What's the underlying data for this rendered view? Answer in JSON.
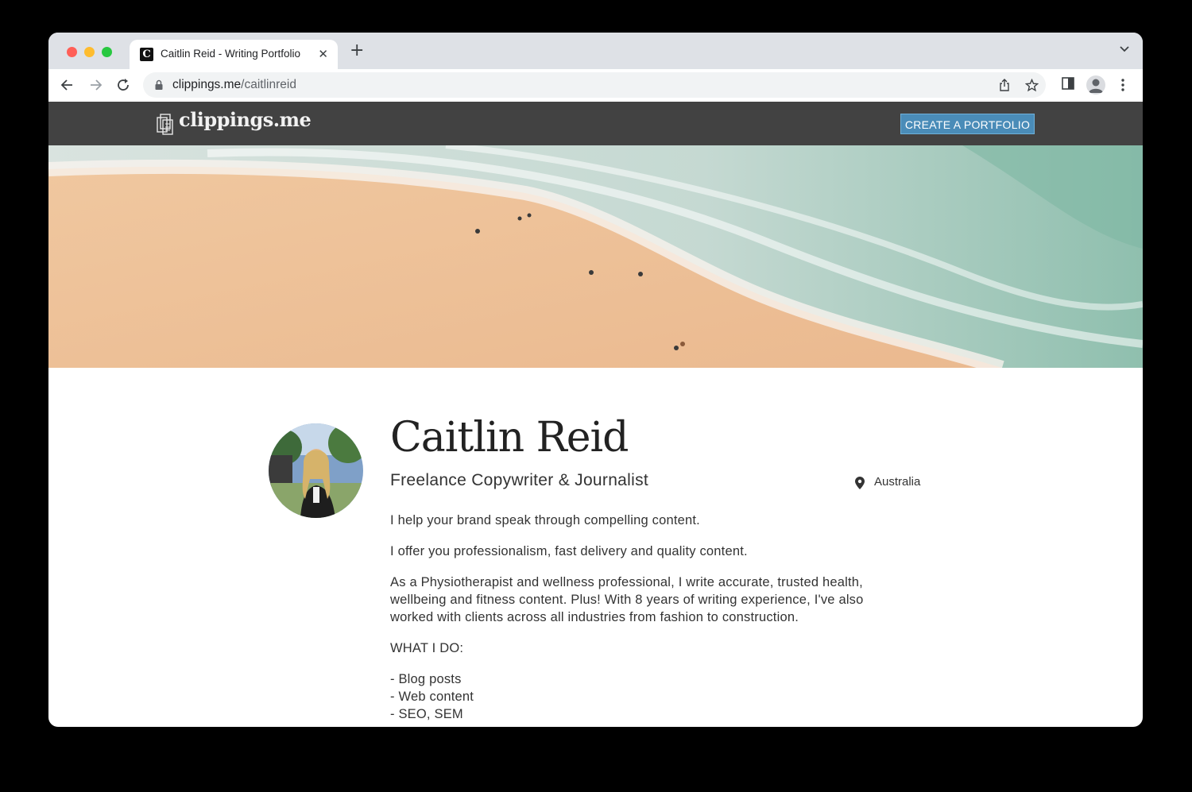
{
  "browser": {
    "tab_title": "Caitlin Reid - Writing Portfolio",
    "tab_favicon_letter": "C",
    "tab_close": "✕",
    "new_tab": "+",
    "url_host": "clippings.me",
    "url_path": "/caitlinreid"
  },
  "site": {
    "logo_text": "clippings.me",
    "cta_label": "CREATE A PORTFOLIO"
  },
  "profile": {
    "name": "Caitlin Reid",
    "tagline": "Freelance Copywriter & Journalist",
    "location": "Australia",
    "bio": {
      "p1": "I help your brand speak through compelling content.",
      "p2": "I offer you professionalism, fast delivery and quality content.",
      "p3": "As a Physiotherapist and wellness professional, I write accurate, trusted health, wellbeing and fitness content. Plus! With 8 years of writing experience, I've also worked with clients across all industries from fashion to construction.",
      "p4": "WHAT I DO:",
      "list": [
        "- Blog posts",
        "- Web content",
        "- SEO, SEM"
      ]
    }
  },
  "colors": {
    "header_bg": "#424242",
    "cta_bg": "#4a8cb8"
  }
}
